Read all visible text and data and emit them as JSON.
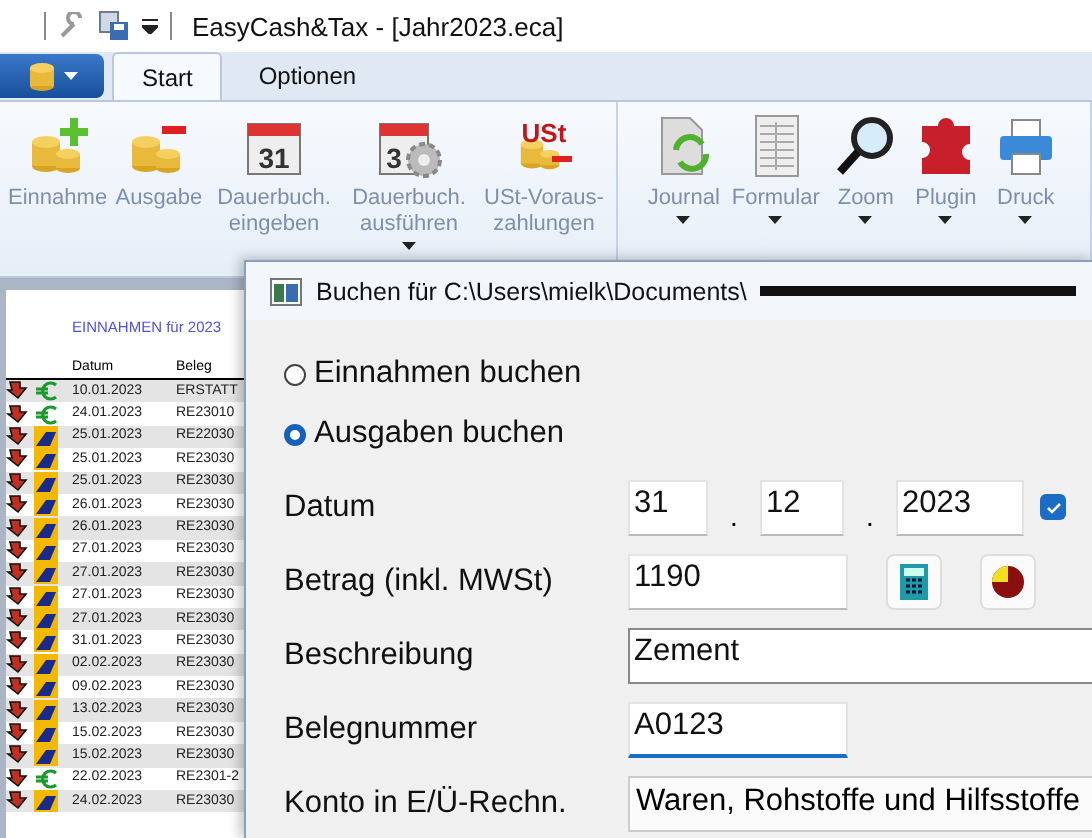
{
  "window": {
    "title": "EasyCash&Tax - [Jahr2023.eca]"
  },
  "ribbon": {
    "tabs": [
      {
        "label": "Start",
        "selected": true
      },
      {
        "label": "Optionen",
        "selected": false
      }
    ],
    "groups": [
      {
        "buttons": [
          {
            "label": "Einnahme",
            "kind": "income",
            "dropdown": false
          },
          {
            "label": "Ausgabe",
            "kind": "expense",
            "dropdown": false
          },
          {
            "label": "Dauerbuch. eingeben",
            "kind": "calendar",
            "icon_text": "31",
            "dropdown": false
          },
          {
            "label": "Dauerbuch. ausführen",
            "kind": "calendargear",
            "icon_text": "3",
            "dropdown": true
          },
          {
            "label": "USt-Voraus- zahlungen",
            "kind": "tax",
            "icon_text": "USt",
            "dropdown": false
          }
        ]
      },
      {
        "buttons": [
          {
            "label": "Journal",
            "kind": "journal",
            "dropdown": true
          },
          {
            "label": "Formular",
            "kind": "form",
            "dropdown": true
          },
          {
            "label": "Zoom",
            "kind": "zoom",
            "dropdown": true
          },
          {
            "label": "Plugin",
            "kind": "plugin",
            "dropdown": true
          },
          {
            "label": "Druck",
            "kind": "printer",
            "dropdown": true
          }
        ]
      }
    ]
  },
  "journal": {
    "heading": "EINNAHMEN für 2023",
    "columns": [
      "Datum",
      "Beleg"
    ],
    "rows": [
      {
        "kind": "income",
        "date": "10.01.2023",
        "beleg": "ERSTATT"
      },
      {
        "kind": "income",
        "date": "24.01.2023",
        "beleg": "RE23010"
      },
      {
        "kind": "expense",
        "date": "25.01.2023",
        "beleg": "RE22030"
      },
      {
        "kind": "expense",
        "date": "25.01.2023",
        "beleg": "RE23030"
      },
      {
        "kind": "expense",
        "date": "25.01.2023",
        "beleg": "RE23030"
      },
      {
        "kind": "expense",
        "date": "26.01.2023",
        "beleg": "RE23030"
      },
      {
        "kind": "expense",
        "date": "26.01.2023",
        "beleg": "RE23030"
      },
      {
        "kind": "expense",
        "date": "27.01.2023",
        "beleg": "RE23030"
      },
      {
        "kind": "expense",
        "date": "27.01.2023",
        "beleg": "RE23030"
      },
      {
        "kind": "expense",
        "date": "27.01.2023",
        "beleg": "RE23030"
      },
      {
        "kind": "expense",
        "date": "27.01.2023",
        "beleg": "RE23030"
      },
      {
        "kind": "expense",
        "date": "31.01.2023",
        "beleg": "RE23030"
      },
      {
        "kind": "expense",
        "date": "02.02.2023",
        "beleg": "RE23030"
      },
      {
        "kind": "expense",
        "date": "09.02.2023",
        "beleg": "RE23030"
      },
      {
        "kind": "expense",
        "date": "13.02.2023",
        "beleg": "RE23030"
      },
      {
        "kind": "expense",
        "date": "15.02.2023",
        "beleg": "RE23030"
      },
      {
        "kind": "expense",
        "date": "15.02.2023",
        "beleg": "RE23030"
      },
      {
        "kind": "income",
        "date": "22.02.2023",
        "beleg": "RE2301-2"
      },
      {
        "kind": "expense",
        "date": "24.02.2023",
        "beleg": "RE23030"
      }
    ]
  },
  "dialog": {
    "title": "Buchen für C:\\Users\\mielk\\Documents\\",
    "radios": [
      {
        "label": "Einnahmen buchen",
        "selected": false
      },
      {
        "label": "Ausgaben buchen",
        "selected": true
      }
    ],
    "date": {
      "label": "Datum",
      "day": "31",
      "month": "12",
      "year": "2023",
      "separator": ".",
      "checked": true
    },
    "amount": {
      "label": "Betrag (inkl. MWSt)",
      "value": "1190"
    },
    "description": {
      "label": "Beschreibung",
      "value": "Zement"
    },
    "receipt": {
      "label": "Belegnummer",
      "value": "A0123",
      "focused": true
    },
    "account": {
      "label": "Konto in E/Ü-Rechn.",
      "value": "Waren, Rohstoffe und Hilfsstoffe"
    }
  }
}
